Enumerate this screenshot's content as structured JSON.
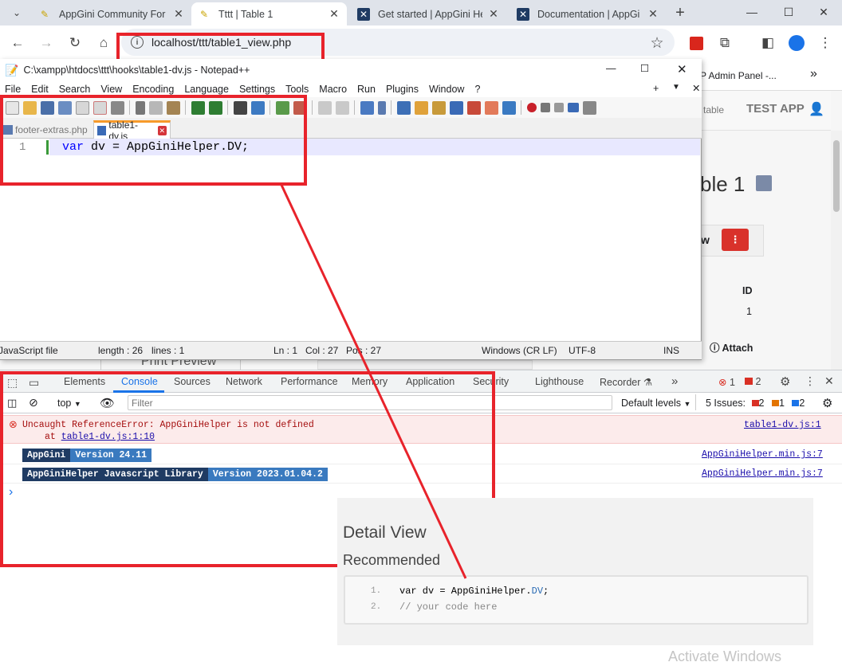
{
  "browser": {
    "tabs": [
      {
        "title": "AppGini Community For",
        "active": false
      },
      {
        "title": "Tttt | Table 1",
        "active": true
      },
      {
        "title": "Get started | AppGini He",
        "active": false
      },
      {
        "title": "Documentation | AppGi",
        "active": false
      }
    ],
    "url": "localhost/ttt/table1_view.php"
  },
  "webpage": {
    "nav_partial": "P Admin Panel -...",
    "table_link": "table",
    "app_name": "TEST APP",
    "heading_partial": "ble 1",
    "detail_partial": "w",
    "id_label": "ID",
    "id_value": "1",
    "attach_label": "Attach",
    "print_preview": "Print Preview"
  },
  "notepad": {
    "title": "C:\\xampp\\htdocs\\ttt\\hooks\\table1-dv.js - Notepad++",
    "menu": [
      "File",
      "Edit",
      "Search",
      "View",
      "Encoding",
      "Language",
      "Settings",
      "Tools",
      "Macro",
      "Run",
      "Plugins",
      "Window",
      "?"
    ],
    "file_tabs": [
      {
        "name": "footer-extras.php",
        "active": false
      },
      {
        "name": "table1-dv.js",
        "active": true
      }
    ],
    "code": {
      "line_no": "1",
      "keyword": "var",
      "rest": " dv = AppGiniHelper.DV;"
    },
    "status": {
      "file_type": "JavaScript file",
      "length": "length : 26",
      "lines": "lines : 1",
      "ln": "Ln : 1",
      "col": "Col : 27",
      "pos": "Pos : 27",
      "eol": "Windows (CR LF)",
      "encoding": "UTF-8",
      "mode": "INS"
    }
  },
  "devtools": {
    "tabs": [
      "Elements",
      "Console",
      "Sources",
      "Network",
      "Performance",
      "Memory",
      "Application",
      "Security",
      "Lighthouse",
      "Recorder"
    ],
    "active_tab": "Console",
    "error_count": "1",
    "warning_count": "2",
    "context": "top",
    "filter_placeholder": "Filter",
    "levels": "Default levels",
    "issues_label": "5 Issues:",
    "issues": {
      "errors": "2",
      "warnings": "1",
      "info": "2"
    },
    "console": {
      "error_message": "Uncaught ReferenceError: AppGiniHelper is not defined",
      "error_at_prefix": "at ",
      "error_at_link": "table1-dv.js:1:10",
      "error_source": "table1-dv.js:1",
      "log1": {
        "badge1": "AppGini",
        "badge2": "Version 24.11",
        "source": "AppGiniHelper.min.js:7"
      },
      "log2": {
        "badge1": "AppGiniHelper Javascript Library",
        "badge2": "Version 2023.01.04.2",
        "source": "AppGiniHelper.min.js:7"
      },
      "prompt": "›"
    }
  },
  "recommended": {
    "title": "Detail View",
    "subtitle": "Recommended",
    "lines": [
      {
        "no": "1.",
        "pre": "var dv = AppGiniHelper.",
        "highlight": "DV",
        "post": ";"
      },
      {
        "no": "2.",
        "comment": "// your code here"
      }
    ]
  },
  "watermark": "Activate Windows",
  "colors": {
    "annotation_red": "#e8232b",
    "badge_dark": "#1f3b63",
    "badge_blue": "#3a7abf"
  }
}
